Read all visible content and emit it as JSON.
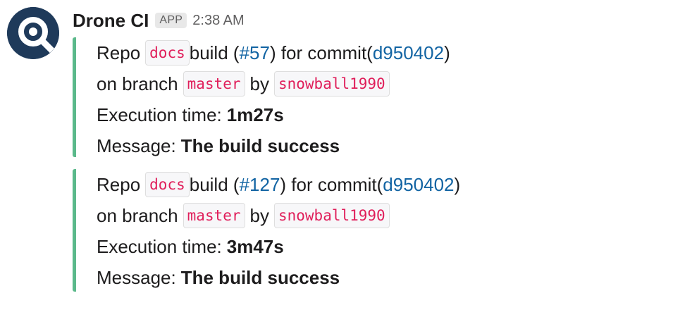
{
  "app": {
    "name": "Drone CI",
    "badge": "APP",
    "time": "2:38 AM",
    "avatar_color": "#1f3a5a",
    "accent_color": "#5bb98b"
  },
  "common": {
    "repo_label": "Repo",
    "build_label": "build (",
    "commit_label": ") for commit(",
    "close_paren": ")",
    "branch_label": "on branch",
    "by_label": "by",
    "exec_label": "Execution time:",
    "message_label": "Message:"
  },
  "messages": [
    {
      "repo": "docs",
      "build_number": "#57",
      "commit": "d950402",
      "branch": "master",
      "author": "snowball1990",
      "execution_time": "1m27s",
      "message": "The build success"
    },
    {
      "repo": "docs",
      "build_number": "#127",
      "commit": "d950402",
      "branch": "master",
      "author": "snowball1990",
      "execution_time": "3m47s",
      "message": "The build success"
    }
  ]
}
